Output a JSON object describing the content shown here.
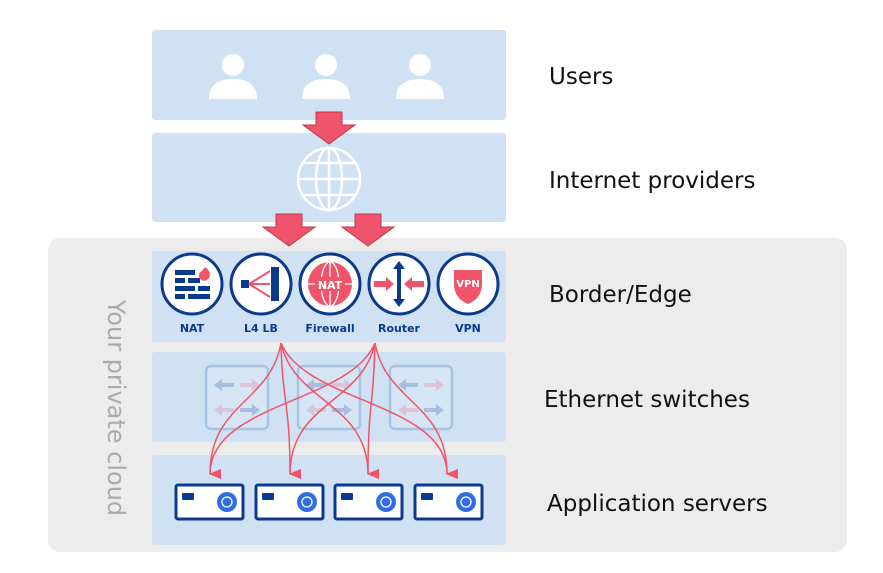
{
  "layers": {
    "users": "Users",
    "internet": "Internet providers",
    "border": "Border/Edge",
    "ethernet": "Ethernet switches",
    "servers": "Application servers"
  },
  "private_cloud_label": "Your private cloud",
  "border_icons": [
    {
      "label": "NAT",
      "icon": "brick-wall-fire-icon"
    },
    {
      "label": "L4 LB",
      "icon": "load-balancer-icon"
    },
    {
      "label": "Firewall",
      "icon": "globe-nat-icon"
    },
    {
      "label": "Router",
      "icon": "router-arrows-icon"
    },
    {
      "label": "VPN",
      "icon": "vpn-shield-icon"
    }
  ],
  "nat_badge": "NAT",
  "vpn_badge": "VPN",
  "colors": {
    "band": "#cfe1f3",
    "navy": "#0b3a8c",
    "red": "#f0546a",
    "cloud": "#ececec"
  }
}
